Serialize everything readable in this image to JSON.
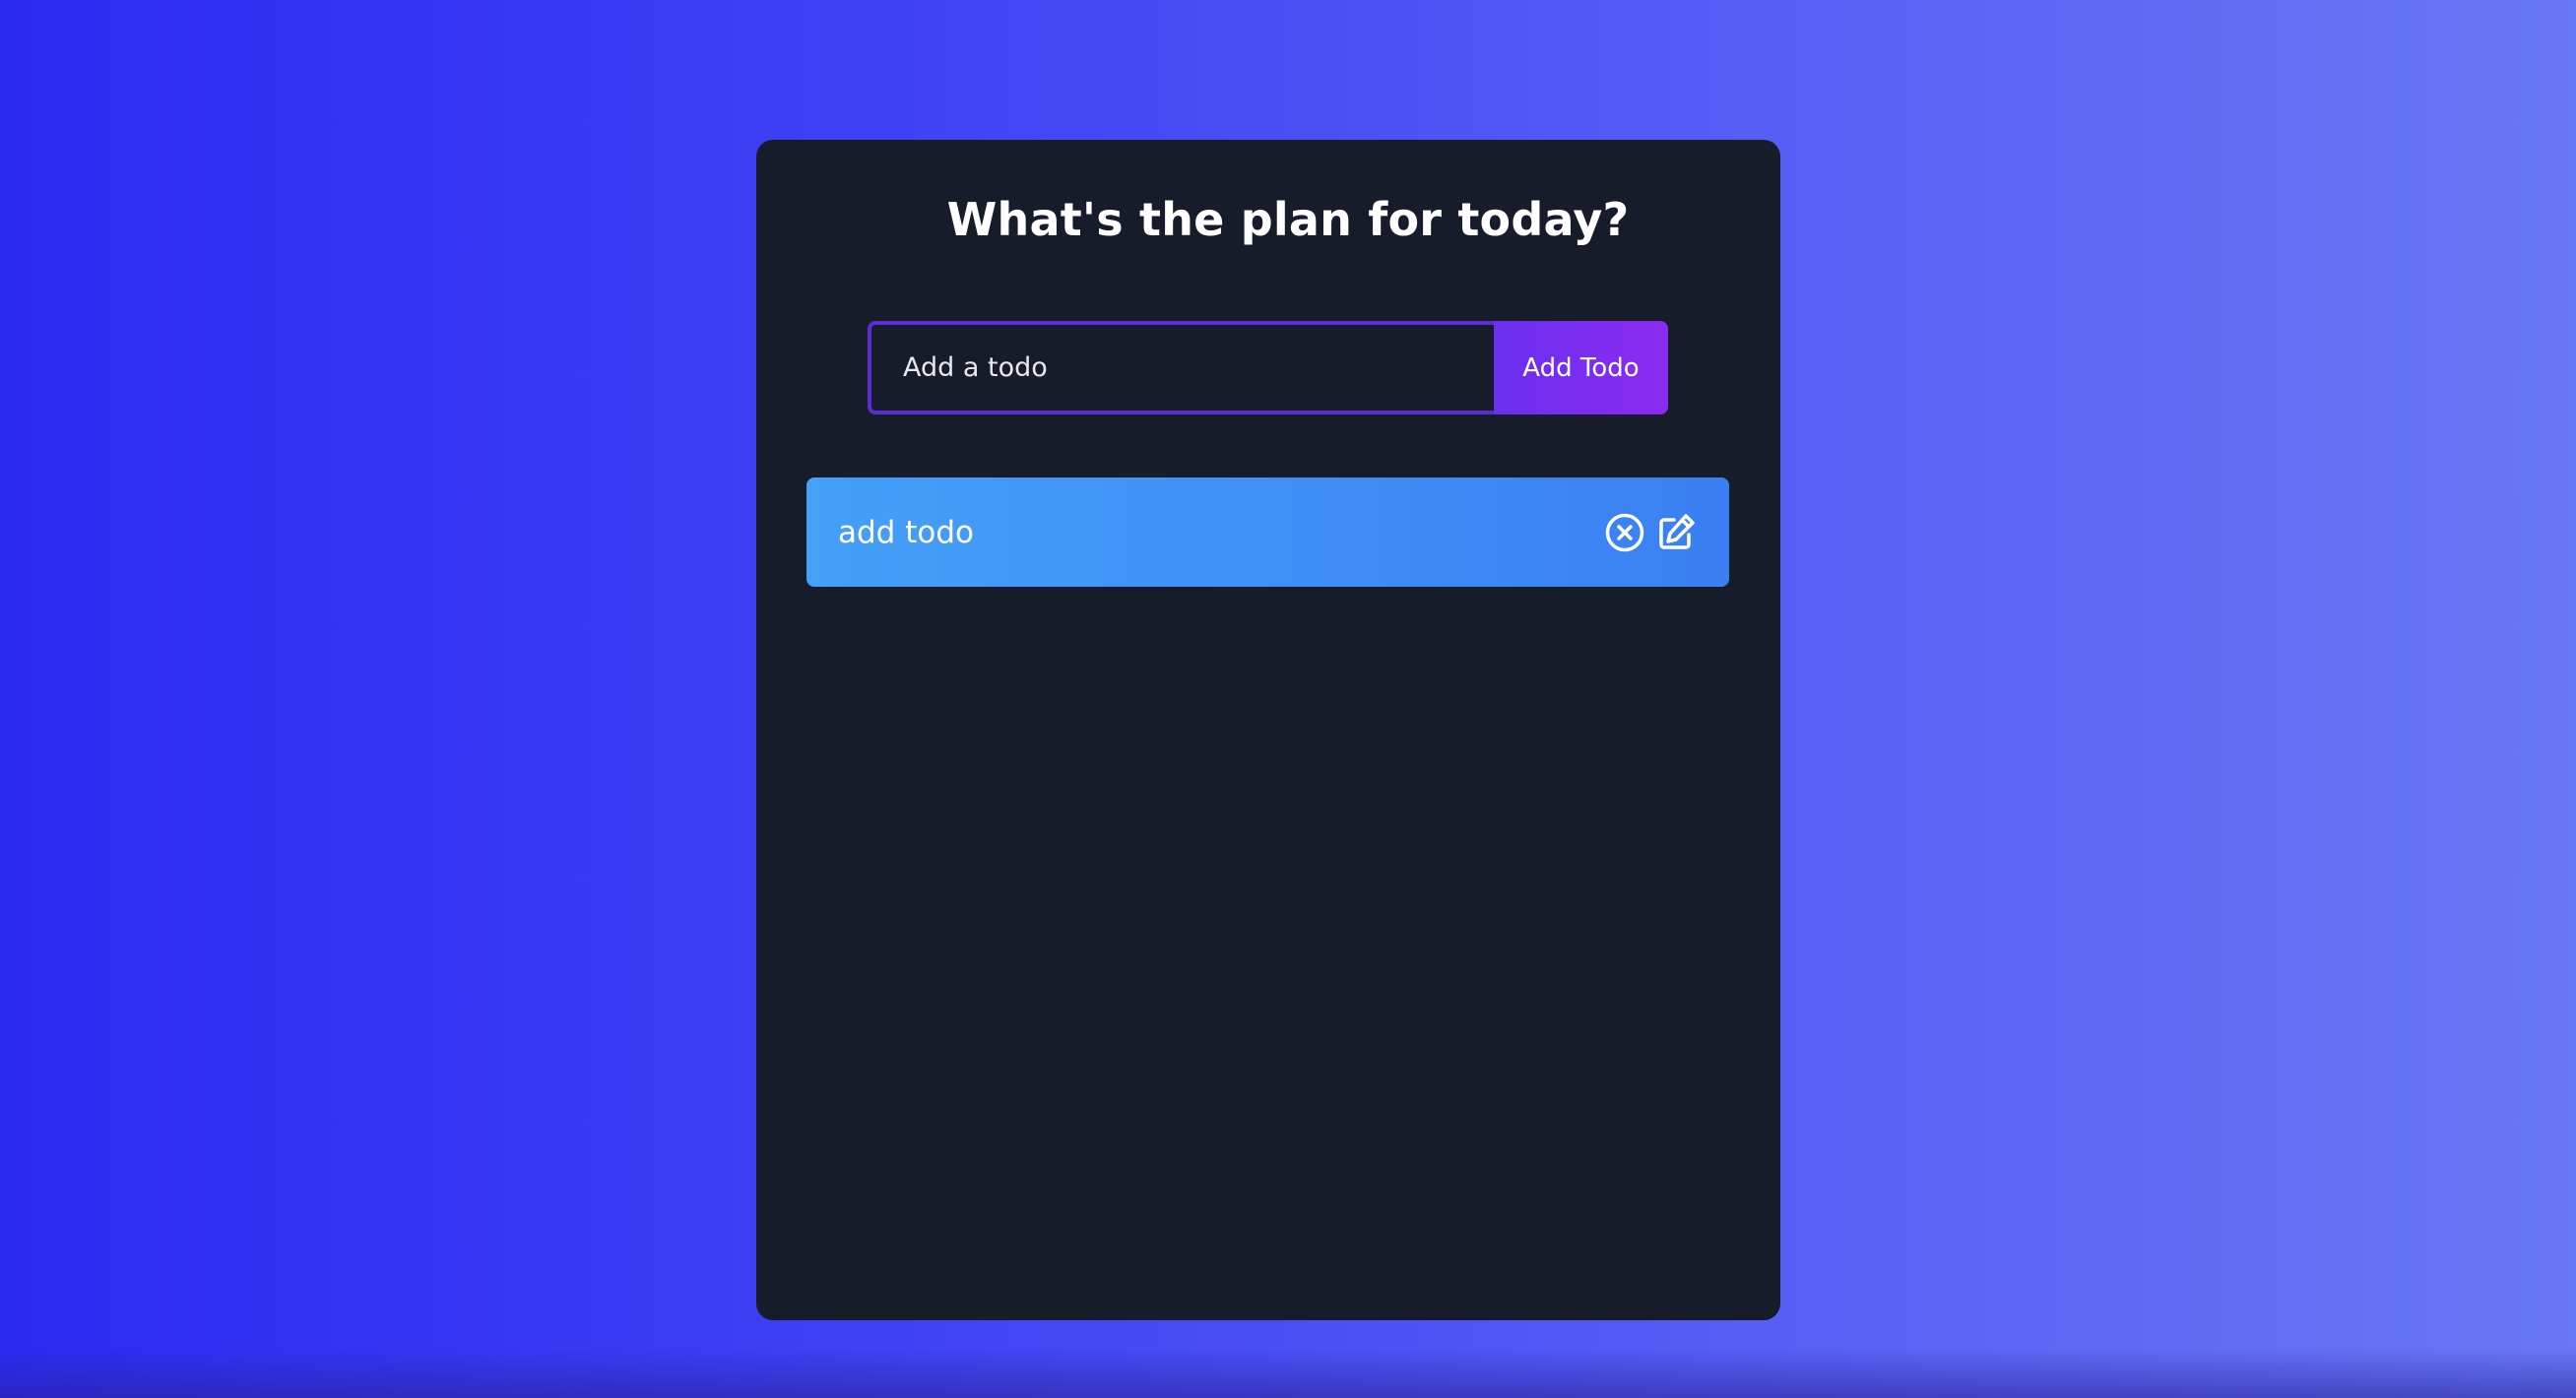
{
  "app": {
    "title": "What's the plan for today?"
  },
  "form": {
    "input_placeholder": "Add a todo",
    "input_value": "",
    "button_label": "Add Todo"
  },
  "todos": [
    {
      "text": "add todo",
      "icons": [
        "delete-icon",
        "edit-icon"
      ]
    }
  ],
  "colors": {
    "background_gradient": [
      "#2b2af2",
      "#6877f4"
    ],
    "card_background": "#171c2a",
    "input_border": "#5b2bd9",
    "button_gradient": [
      "#6a2ff0",
      "#8c2bf0"
    ],
    "todo_row_gradient": [
      "#45a0f8",
      "#3a7ff2"
    ],
    "text": "#ffffff"
  }
}
